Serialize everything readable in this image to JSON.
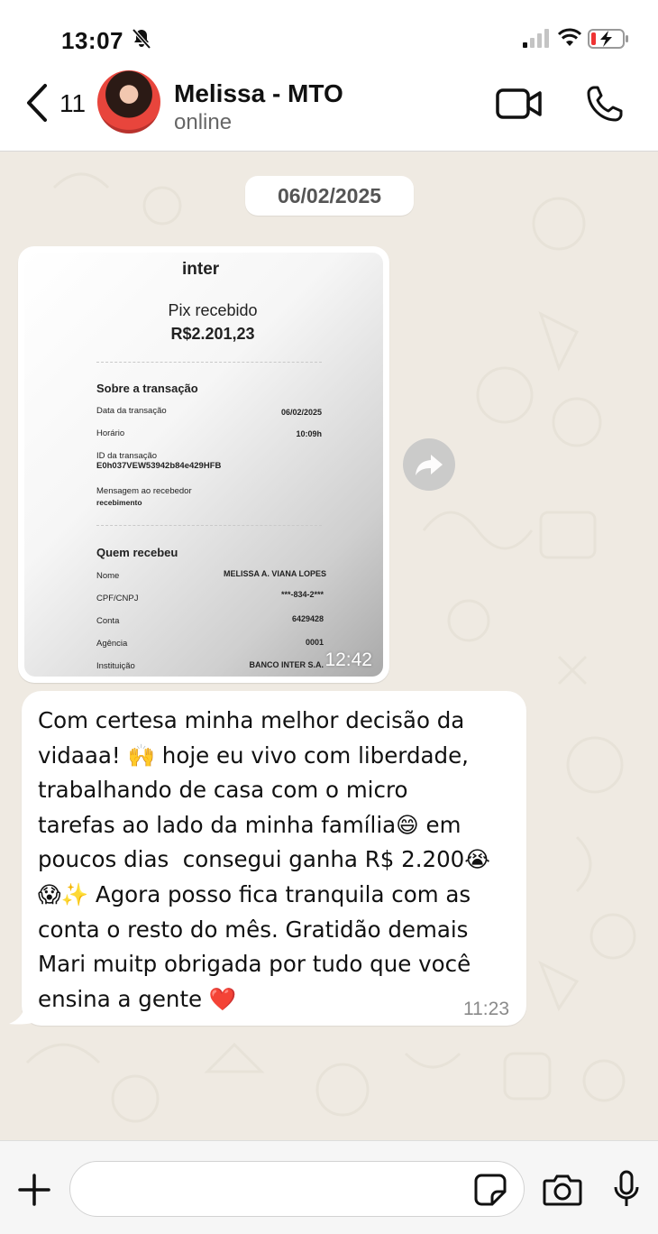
{
  "status_bar": {
    "time": "13:07",
    "icons": [
      "bell-slash-icon",
      "cellular-signal-icon",
      "wifi-icon",
      "battery-charging-icon"
    ]
  },
  "header": {
    "back_count": "11",
    "contact_name": "Melissa - MTO",
    "contact_status": "online",
    "icons": [
      "chevron-left-icon",
      "video-call-icon",
      "phone-call-icon"
    ]
  },
  "chat": {
    "date_separator": "06/02/2025",
    "image_message": {
      "time": "12:42",
      "receipt": {
        "brand": "inter",
        "title": "Pix recebido",
        "amount": "R$2.201,23",
        "section_transaction": "Sobre a transação",
        "date_label": "Data da transação",
        "date_value": "06/02/2025",
        "hour_label": "Horário",
        "hour_value": "10:09h",
        "id_label": "ID da transação",
        "id_value": "E0h037VEW53942b84e429HFB",
        "message_label": "Mensagem ao recebedor",
        "message_value": "recebimento",
        "section_receiver": "Quem recebeu",
        "name_label": "Nome",
        "name_value": "MELISSA A. VIANA LOPES",
        "cpf_label": "CPF/CNPJ",
        "cpf_value": "***-834-2***",
        "account_label": "Conta",
        "account_value": "6429428",
        "agency_label": "Agência",
        "agency_value": "0001",
        "institution_label": "Instituição",
        "institution_value": "BANCO INTER S.A."
      }
    },
    "text_message": {
      "text": "Com certesa minha melhor decisão da\nvidaaa! 🙌 hoje eu vivo com liberdade,\ntrabalhando de casa com o micro\ntarefas ao lado da minha família😄 em\npoucos dias  consegui ganha R$ 2.200😭\n😱✨ Agora posso fica tranquila com as\nconta o resto do mês. Gratidão demais\nMari muitp obrigada por tudo que você\nensina a gente ❤️",
      "time": "11:23"
    }
  },
  "composer": {
    "input_value": "",
    "icons": [
      "plus-icon",
      "sticker-icon",
      "camera-icon",
      "microphone-icon"
    ]
  },
  "colors": {
    "chat_background": "#efeae2",
    "bubble": "#ffffff",
    "inter_orange": "#ff7a00"
  }
}
